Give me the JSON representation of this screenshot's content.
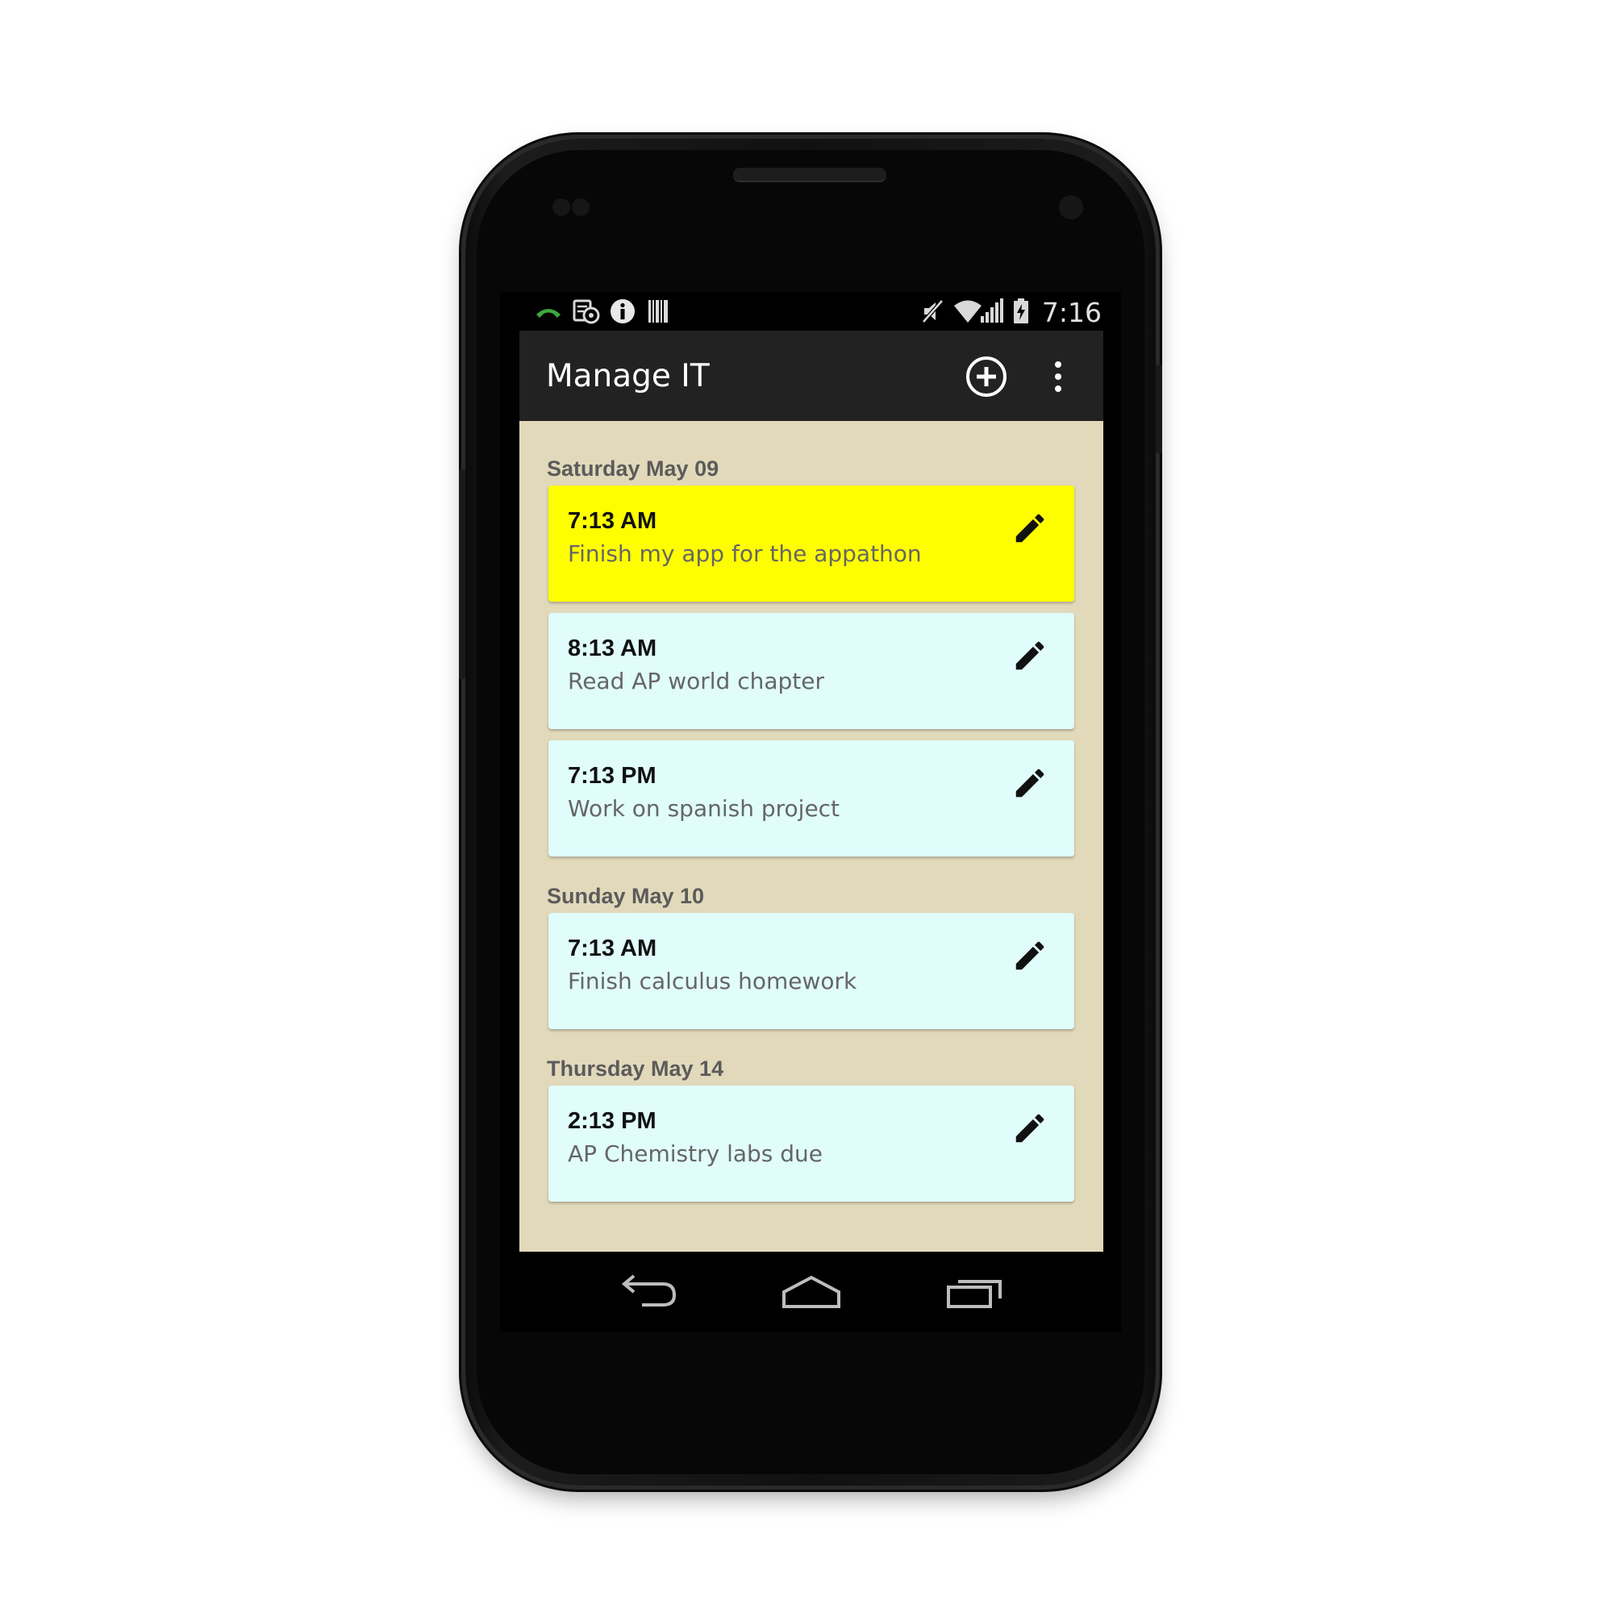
{
  "status_bar": {
    "time": "7:16",
    "left_icons": [
      "call-icon",
      "screenshot-icon",
      "info-icon",
      "barcode-icon"
    ],
    "right_icons": [
      "mute-icon",
      "wifi-icon",
      "signal-icon",
      "battery-charging-icon"
    ]
  },
  "app_bar": {
    "title": "Manage IT",
    "actions": [
      "add-circle-icon",
      "overflow-menu-icon"
    ]
  },
  "colors": {
    "app_bar": "#222222",
    "background": "#e2d9bb",
    "card": "#e0fcfb",
    "card_highlight": "#fffe00"
  },
  "groups": [
    {
      "date": "Saturday May 09",
      "items": [
        {
          "time": "7:13 AM",
          "task": "Finish my app for the appathon",
          "highlighted": true
        },
        {
          "time": "8:13 AM",
          "task": "Read AP world chapter",
          "highlighted": false
        },
        {
          "time": "7:13 PM",
          "task": "Work on spanish project",
          "highlighted": false
        }
      ]
    },
    {
      "date": "Sunday May 10",
      "items": [
        {
          "time": "7:13 AM",
          "task": "Finish calculus homework",
          "highlighted": false
        }
      ]
    },
    {
      "date": "Thursday May 14",
      "items": [
        {
          "time": "2:13 PM",
          "task": "AP Chemistry labs due",
          "highlighted": false
        }
      ]
    }
  ],
  "nav_bar": [
    "back-icon",
    "home-icon",
    "recents-icon"
  ]
}
